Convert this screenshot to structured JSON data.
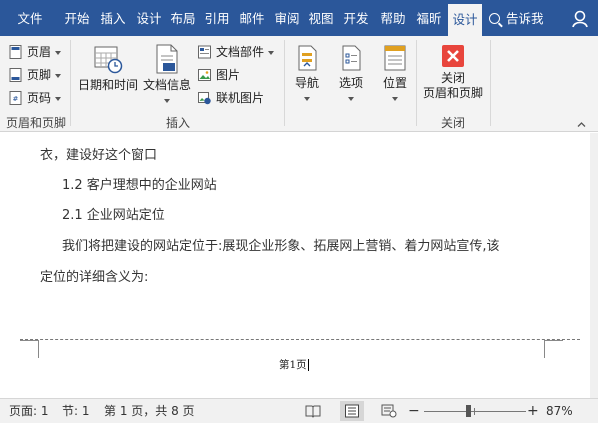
{
  "tabs": [
    {
      "label": "文件"
    },
    {
      "label": "开始"
    },
    {
      "label": "插入"
    },
    {
      "label": "设计"
    },
    {
      "label": "布局"
    },
    {
      "label": "引用"
    },
    {
      "label": "邮件"
    },
    {
      "label": "审阅"
    },
    {
      "label": "视图"
    },
    {
      "label": "开发"
    },
    {
      "label": "帮助"
    },
    {
      "label": "福昕"
    },
    {
      "label": "设计"
    }
  ],
  "tell_me": "告诉我",
  "ribbon": {
    "header_footer_group": {
      "label": "页眉和页脚",
      "header": "页眉",
      "footer": "页脚",
      "page_number": "页码"
    },
    "insert_group": {
      "label": "插入",
      "date_time": "日期和时间",
      "doc_info": "文档信息",
      "quick_parts": "文档部件",
      "pictures": "图片",
      "online_pictures": "联机图片"
    },
    "navigation": "导航",
    "options": "选项",
    "position": "位置",
    "close_group": {
      "label": "关闭",
      "close_line1": "关闭",
      "close_line2": "页眉和页脚"
    }
  },
  "document": {
    "lines": [
      "衣，建设好这个窗口",
      "1.2 客户理想中的企业网站",
      "2.1 企业网站定位",
      "我们将把建设的网站定位于:展现企业形象、拓展网上营销、着力网站宣传,该",
      "定位的详细含义为:"
    ],
    "footer_text": "第1页"
  },
  "status": {
    "page": "页面: 1",
    "section": "节: 1",
    "page_of": "第 1 页，共 8 页",
    "zoom": "87%",
    "zoom_level": 0.87
  },
  "colors": {
    "accent": "#2b579a",
    "close_red": "#e8453c"
  }
}
